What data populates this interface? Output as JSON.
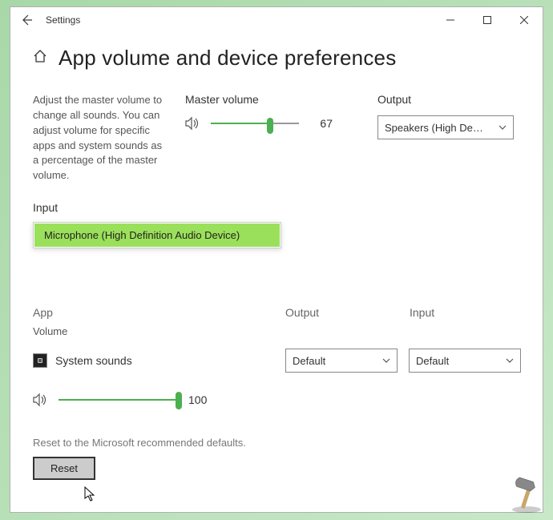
{
  "window": {
    "title": "Settings"
  },
  "page": {
    "title": "App volume and device preferences",
    "description": "Adjust the master volume to change all sounds. You can adjust volume for specific apps and system sounds as a percentage of the master volume."
  },
  "master": {
    "label": "Master volume",
    "value": "67",
    "percent": 67
  },
  "output": {
    "label": "Output",
    "selected": "Speakers (High De…"
  },
  "input": {
    "label": "Input",
    "selected": "Microphone (High Definition Audio Device)"
  },
  "app_section": {
    "app_header": "App",
    "volume_header": "Volume",
    "output_header": "Output",
    "input_header": "Input"
  },
  "app_row": {
    "name": "System sounds",
    "volume": "100",
    "percent": 100,
    "output": "Default",
    "input": "Default"
  },
  "reset": {
    "description": "Reset to the Microsoft recommended defaults.",
    "button": "Reset"
  }
}
